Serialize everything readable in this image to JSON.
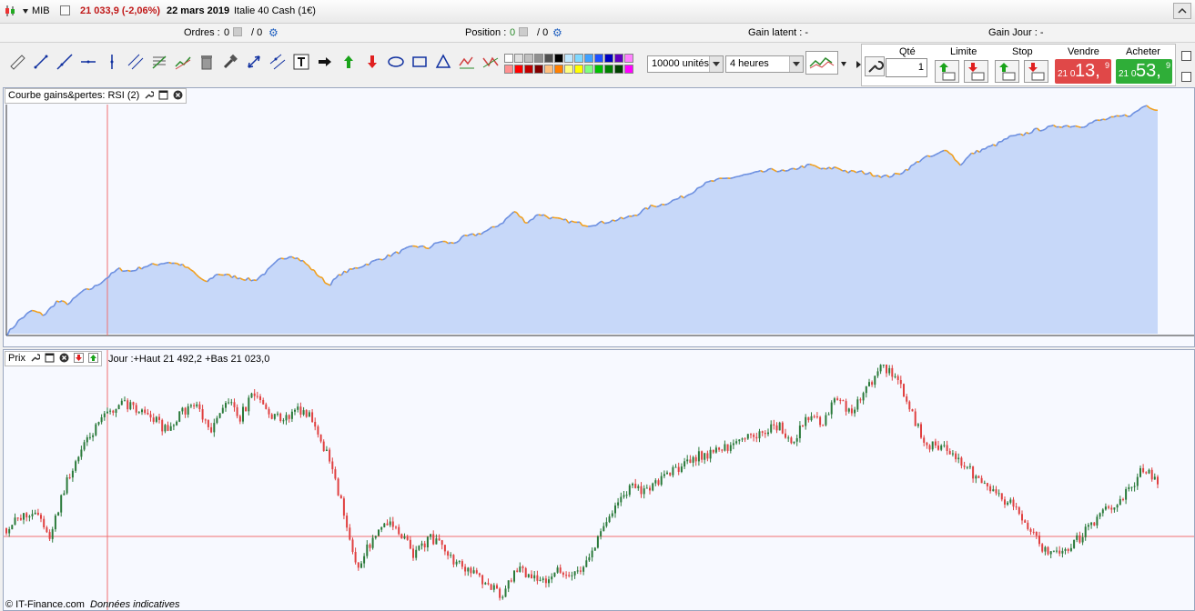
{
  "header": {
    "symbol": "MIB",
    "price_change": "21 033,9 (-2,06%)",
    "date": "22 mars 2019",
    "instrument": "Italie 40 Cash (1€)"
  },
  "status": {
    "orders_label": "Ordres :",
    "orders_value": "0",
    "orders_total": "/ 0",
    "position_label": "Position :",
    "position_value": "0",
    "position_total": "/ 0",
    "gain_latent": "Gain latent : -",
    "gain_jour": "Gain Jour : -"
  },
  "toolbar": {
    "units_value": "10000 unités",
    "timeframe_value": "4 heures",
    "palette_top": [
      "#ffffff",
      "#e0e0e0",
      "#c0c0c0",
      "#909090",
      "#505050",
      "#000000",
      "#c0e8ff",
      "#80d8ff",
      "#40a0ff",
      "#2050ff",
      "#0000c0",
      "#6000c0",
      "#ff80ff"
    ],
    "palette_bottom": [
      "#ff9090",
      "#ff0000",
      "#c00000",
      "#800000",
      "#ffc080",
      "#ff8000",
      "#ffff80",
      "#ffff00",
      "#80ff80",
      "#00c000",
      "#008000",
      "#004000",
      "#ff00ff"
    ]
  },
  "trade": {
    "qty_label": "Qté",
    "qty_value": "1",
    "limit_label": "Limite",
    "stop_label": "Stop",
    "sell_label": "Vendre",
    "buy_label": "Acheter",
    "sell_prefix": "21 0",
    "sell_main": "13,",
    "sell_sup": "9",
    "buy_prefix": "21 0",
    "buy_main": "53,",
    "buy_sup": "9",
    "sell_color": "#e04848",
    "buy_color": "#2fae38"
  },
  "panels": {
    "equity_title": "Courbe gains&pertes: RSI (2)",
    "price_title": "Prix",
    "price_info": "Jour :+Haut 21 492,2 +Bas 21 023,0"
  },
  "footer": {
    "copyright": "© IT-Finance.com",
    "disclaimer": "Données indicatives"
  },
  "chart_data": [
    {
      "type": "area",
      "y": [
        0.0,
        0.06,
        0.1,
        0.08,
        0.14,
        0.13,
        0.18,
        0.2,
        0.24,
        0.28,
        0.27,
        0.29,
        0.3,
        0.31,
        0.3,
        0.27,
        0.22,
        0.26,
        0.25,
        0.24,
        0.23,
        0.27,
        0.32,
        0.34,
        0.31,
        0.26,
        0.21,
        0.26,
        0.28,
        0.3,
        0.32,
        0.34,
        0.36,
        0.38,
        0.37,
        0.4,
        0.39,
        0.42,
        0.43,
        0.45,
        0.48,
        0.53,
        0.48,
        0.52,
        0.5,
        0.49,
        0.48,
        0.47,
        0.48,
        0.49,
        0.5,
        0.52,
        0.55,
        0.56,
        0.58,
        0.6,
        0.64,
        0.66,
        0.67,
        0.68,
        0.69,
        0.7,
        0.71,
        0.7,
        0.72,
        0.73,
        0.71,
        0.72,
        0.7,
        0.7,
        0.69,
        0.68,
        0.69,
        0.72,
        0.76,
        0.77,
        0.8,
        0.73,
        0.78,
        0.8,
        0.82,
        0.85,
        0.86,
        0.88,
        0.89,
        0.9,
        0.9,
        0.9,
        0.92,
        0.93,
        0.94,
        0.95,
        0.99,
        0.97
      ]
    },
    {
      "type": "line",
      "y": [
        0.3,
        0.34,
        0.38,
        0.26,
        0.48,
        0.62,
        0.72,
        0.8,
        0.84,
        0.82,
        0.78,
        0.72,
        0.8,
        0.84,
        0.7,
        0.86,
        0.78,
        0.88,
        0.8,
        0.76,
        0.82,
        0.78,
        0.62,
        0.4,
        0.12,
        0.24,
        0.34,
        0.28,
        0.18,
        0.26,
        0.22,
        0.14,
        0.1,
        0.06,
        0.0,
        0.12,
        0.1,
        0.08,
        0.12,
        0.1,
        0.16,
        0.32,
        0.42,
        0.48,
        0.46,
        0.52,
        0.56,
        0.6,
        0.62,
        0.64,
        0.66,
        0.7,
        0.72,
        0.74,
        0.68,
        0.78,
        0.76,
        0.86,
        0.8,
        0.9,
        1.0,
        0.96,
        0.82,
        0.66,
        0.66,
        0.6,
        0.56,
        0.48,
        0.44,
        0.4,
        0.3,
        0.22,
        0.18,
        0.22,
        0.28,
        0.36,
        0.4,
        0.46,
        0.56,
        0.5
      ]
    }
  ]
}
